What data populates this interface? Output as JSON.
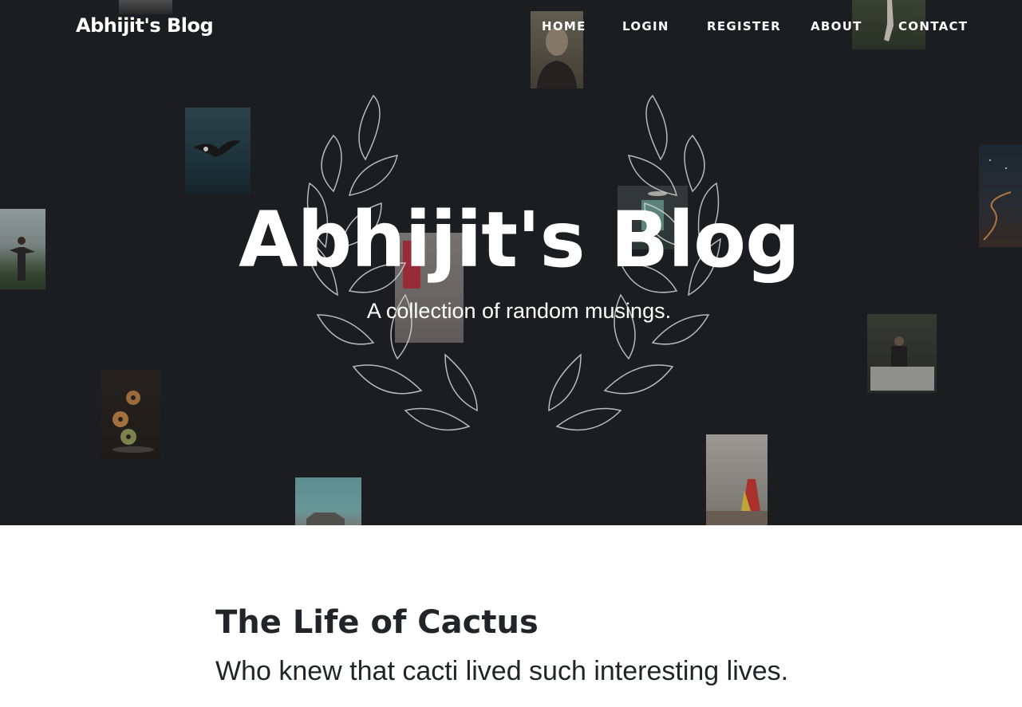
{
  "brand": "Abhijit's Blog",
  "nav": {
    "home": "HOME",
    "login": "LOGIN",
    "register": "REGISTER",
    "about": "ABOUT",
    "contact": "CONTACT"
  },
  "hero": {
    "title": "Abhijit's Blog",
    "subtitle": "A collection of random musings."
  },
  "post": {
    "title": "The Life of Cactus",
    "subtitle": "Who knew that cacti lived such interesting lives."
  },
  "colors": {
    "hero_background": "#1c1d20",
    "text_light": "#ffffff",
    "text_dark": "#212529"
  },
  "icons": [
    "laurel-wreath-icon"
  ]
}
